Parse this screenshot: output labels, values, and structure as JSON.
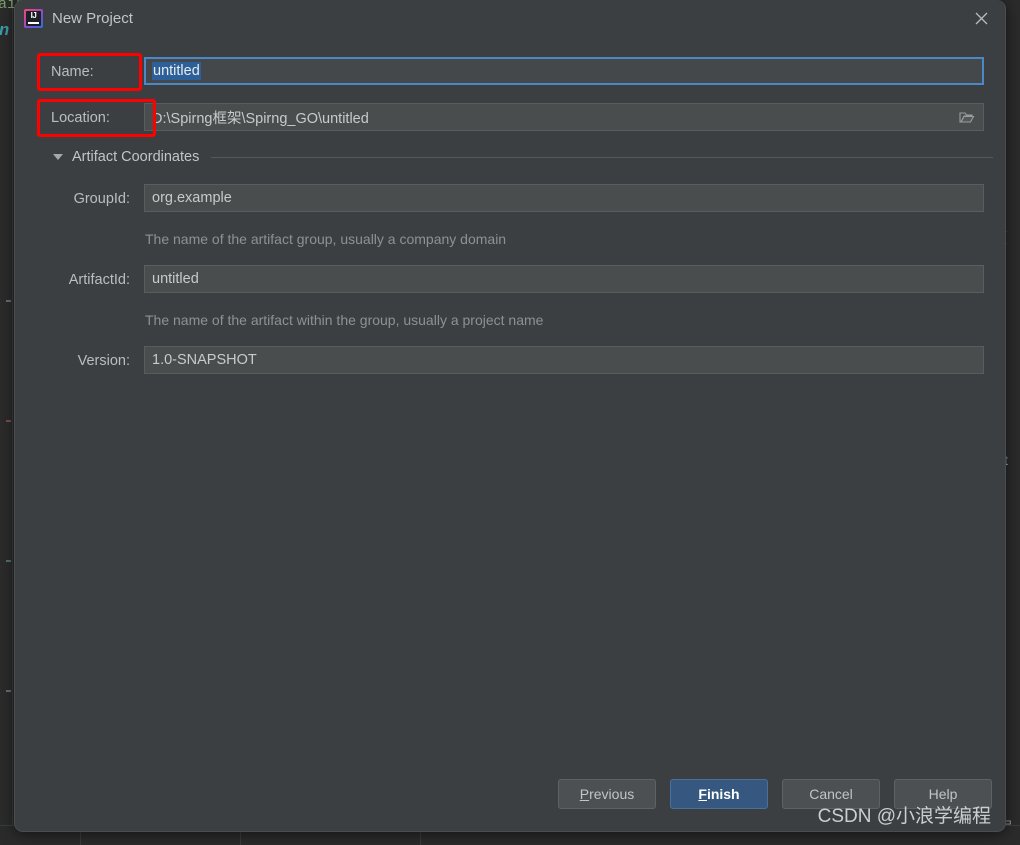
{
  "window": {
    "title": "New Project",
    "app_icon": "intellij-idea-icon",
    "close_icon": "close-icon"
  },
  "form": {
    "name": {
      "label": "Name:",
      "value": "untitled",
      "selected": true,
      "focused": true,
      "annotated": true
    },
    "location": {
      "label": "Location:",
      "value": "D:\\Spirng框架\\Spirng_GO\\untitled",
      "browse_icon": "folder-open-icon",
      "annotated": true
    }
  },
  "artifact_section": {
    "title": "Artifact Coordinates",
    "expanded": true,
    "expander_icon": "chevron-down-icon",
    "fields": [
      {
        "label": "GroupId:",
        "value": "org.example",
        "hint": "The name of the artifact group, usually a company domain"
      },
      {
        "label": "ArtifactId:",
        "value": "untitled",
        "hint": "The name of the artifact within the group, usually a project name"
      },
      {
        "label": "Version:",
        "value": "1.0-SNAPSHOT",
        "hint": ""
      }
    ]
  },
  "buttons": {
    "previous": {
      "label_pre": "",
      "label_mnemonic": "P",
      "label_post": "revious"
    },
    "finish": {
      "label_pre": "",
      "label_mnemonic": "F",
      "label_post": "inish"
    },
    "cancel": {
      "label": "Cancel"
    },
    "help": {
      "label": "Help"
    }
  },
  "watermark": {
    "text": "CSDN @小浪学编程"
  },
  "background": {
    "code_green": "ain",
    "code_cyan": "n",
    "right_glyph_1": "(",
    "right_glyph_2": "t",
    "right_glyph_3": "程"
  },
  "colors": {
    "dialog_bg": "#3c3f41",
    "field_bg": "#4a4d4e",
    "accent_blue": "#365880",
    "focus_border": "#4a88c7",
    "selection_blue": "#2d6099",
    "annotation_red": "#fe0000",
    "text_primary": "#c2c4c6",
    "text_hint": "#8e9194"
  }
}
